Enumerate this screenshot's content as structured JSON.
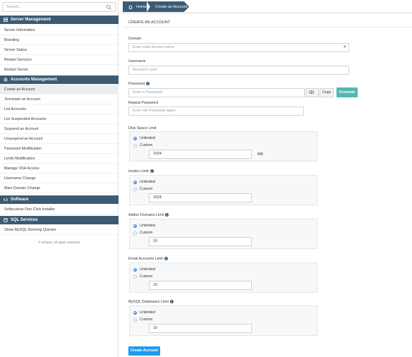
{
  "search": {
    "placeholder": "Search..."
  },
  "sidebar": {
    "sections": [
      {
        "title": "Server Management",
        "items": [
          "Server Information",
          "Branding",
          "Server Status",
          "Restart Services",
          "Restart Server"
        ]
      },
      {
        "title": "Accounts Management",
        "items": [
          "Create an Account",
          "Terminate an Account",
          "List Accounts",
          "List Suspended Accounts",
          "Suspend an Account",
          "Unsuspend an Account",
          "Password Modification",
          "Limits Modification",
          "Manage SSH Access",
          "Username Change",
          "Main Domain Change"
        ]
      },
      {
        "title": "Software",
        "items": [
          "Softaculous One Click Installer"
        ]
      },
      {
        "title": "SQL Services",
        "items": [
          "Show MySQL Running Queries"
        ]
      }
    ],
    "active_item": "Create an Account",
    "copyright": "© SPanel. All rights reserved."
  },
  "breadcrumb": {
    "home": "Home",
    "current": "Create an Account"
  },
  "form": {
    "title": "CREATE AN ACCOUNT",
    "domain": {
      "label": "Domain",
      "placeholder": "Enter valid domain name",
      "clear": "×"
    },
    "username": {
      "label": "Username",
      "placeholder": "Account's user"
    },
    "password": {
      "label": "Password",
      "placeholder": "Enter a Password",
      "copy": "Copy",
      "generate": "Generate"
    },
    "repeat_password": {
      "label": "Repeat Password",
      "placeholder": "Enter the Password again"
    },
    "limits": [
      {
        "label": "Disk Space Limit",
        "info": false,
        "unlimited": "Unlimited",
        "custom": "Custom",
        "value": "1024",
        "unit": "MB",
        "selected": "unlimited"
      },
      {
        "label": "Inodes Limit",
        "info": true,
        "unlimited": "Unlimited",
        "custom": "Custom",
        "value": "1024",
        "unit": "",
        "selected": "unlimited"
      },
      {
        "label": "Addon Domains Limit",
        "info": true,
        "unlimited": "Unlimited",
        "custom": "Custom",
        "value": "10",
        "unit": "",
        "selected": "unlimited"
      },
      {
        "label": "Email Accounts Limit",
        "info": true,
        "unlimited": "Unlimited",
        "custom": "Custom",
        "value": "10",
        "unit": "",
        "selected": "unlimited"
      },
      {
        "label": "MySQL Databases Limit",
        "info": true,
        "unlimited": "Unlimited",
        "custom": "Custom",
        "value": "10",
        "unit": "",
        "selected": "unlimited"
      }
    ],
    "submit": "Create Account"
  },
  "colors": {
    "nav": "#3c5b73",
    "generate": "#4fb8b3",
    "primary": "#1e9bf0"
  }
}
